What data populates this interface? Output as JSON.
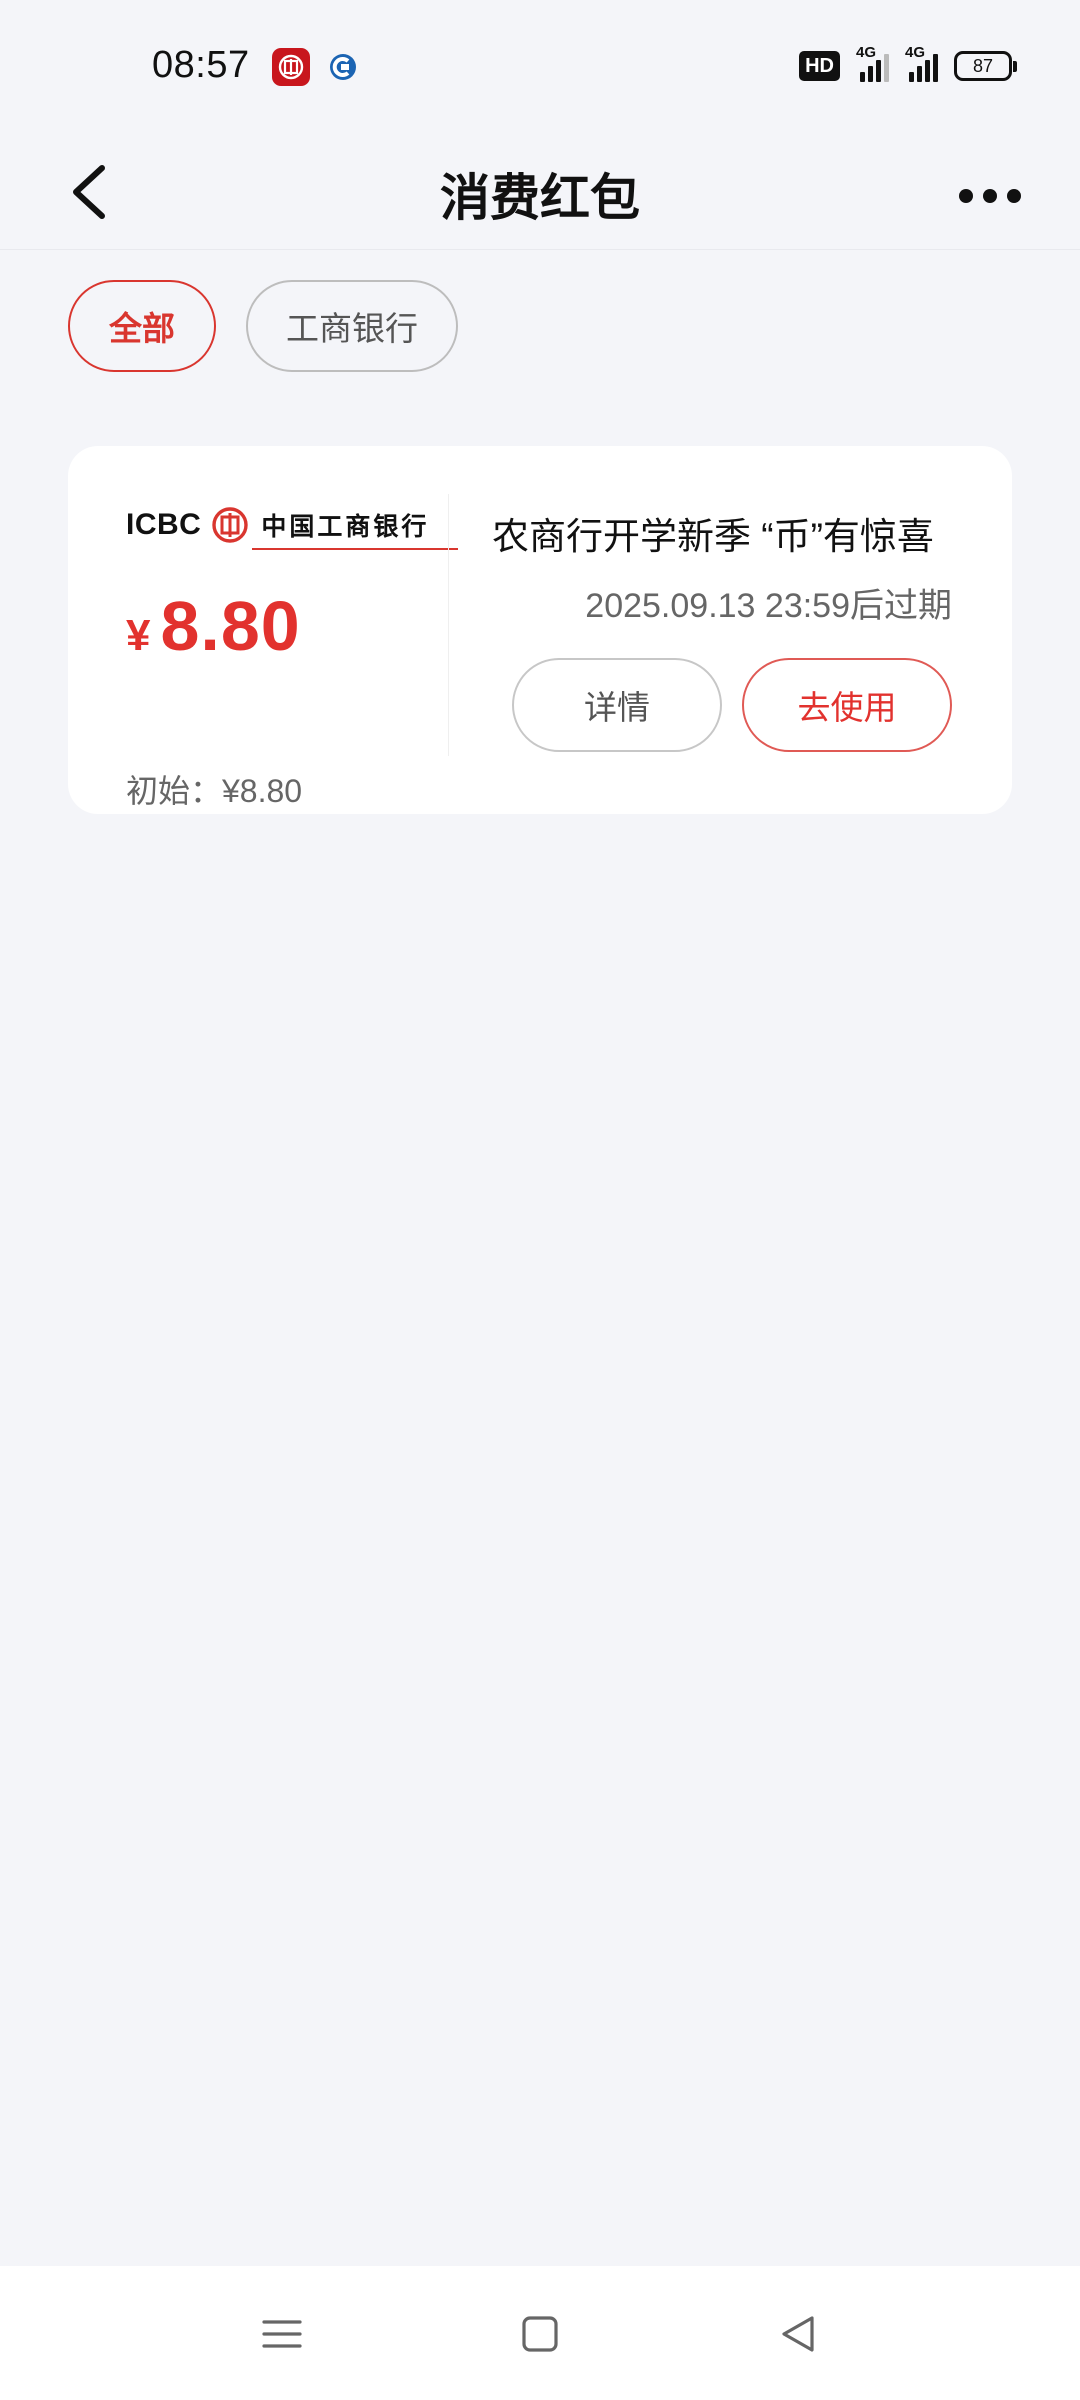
{
  "status_bar": {
    "time": "08:57",
    "app_icons": [
      "icbc-app-icon",
      "ccb-app-icon"
    ],
    "hd_label": "HD",
    "signal_1_label": "4G",
    "signal_2_label": "4G",
    "battery_level": "87"
  },
  "header": {
    "title": "消费红包",
    "back_icon": "chevron-left-icon",
    "more_icon": "more-dots-icon"
  },
  "filters": [
    {
      "label": "全部",
      "active": true
    },
    {
      "label": "工商银行",
      "active": false
    }
  ],
  "card": {
    "bank_logo_text_en": "ICBC",
    "bank_logo_text_cn": "中国工商银行",
    "currency": "¥",
    "amount": "8.80",
    "initial_label": "初始：¥8.80",
    "title": "农商行开学新季 “币”有惊喜",
    "expiry": "2025.09.13 23:59后过期",
    "detail_button": "详情",
    "use_button": "去使用"
  },
  "nav_bar": {
    "icons": [
      "menu-icon",
      "home-square-icon",
      "back-triangle-icon"
    ]
  },
  "colors": {
    "accent_red": "#e2322e",
    "background": "#f4f5f9",
    "card_bg": "#ffffff"
  }
}
